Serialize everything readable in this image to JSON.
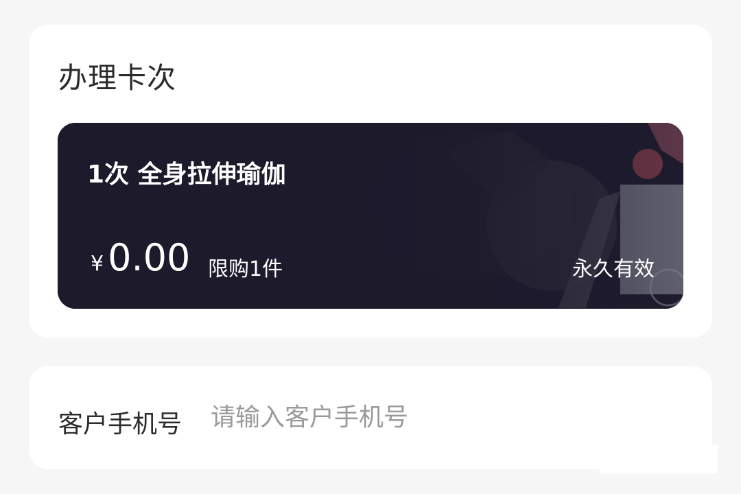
{
  "section": {
    "title": "办理卡次"
  },
  "card": {
    "name": "1次 全身拉伸瑜伽",
    "currency": "¥",
    "price": "0.00",
    "limit": "限购1件",
    "validity": "永久有效",
    "background": "#1c1a2b"
  },
  "customer": {
    "label": "客户手机号",
    "placeholder": "请输入客户手机号",
    "value": ""
  }
}
